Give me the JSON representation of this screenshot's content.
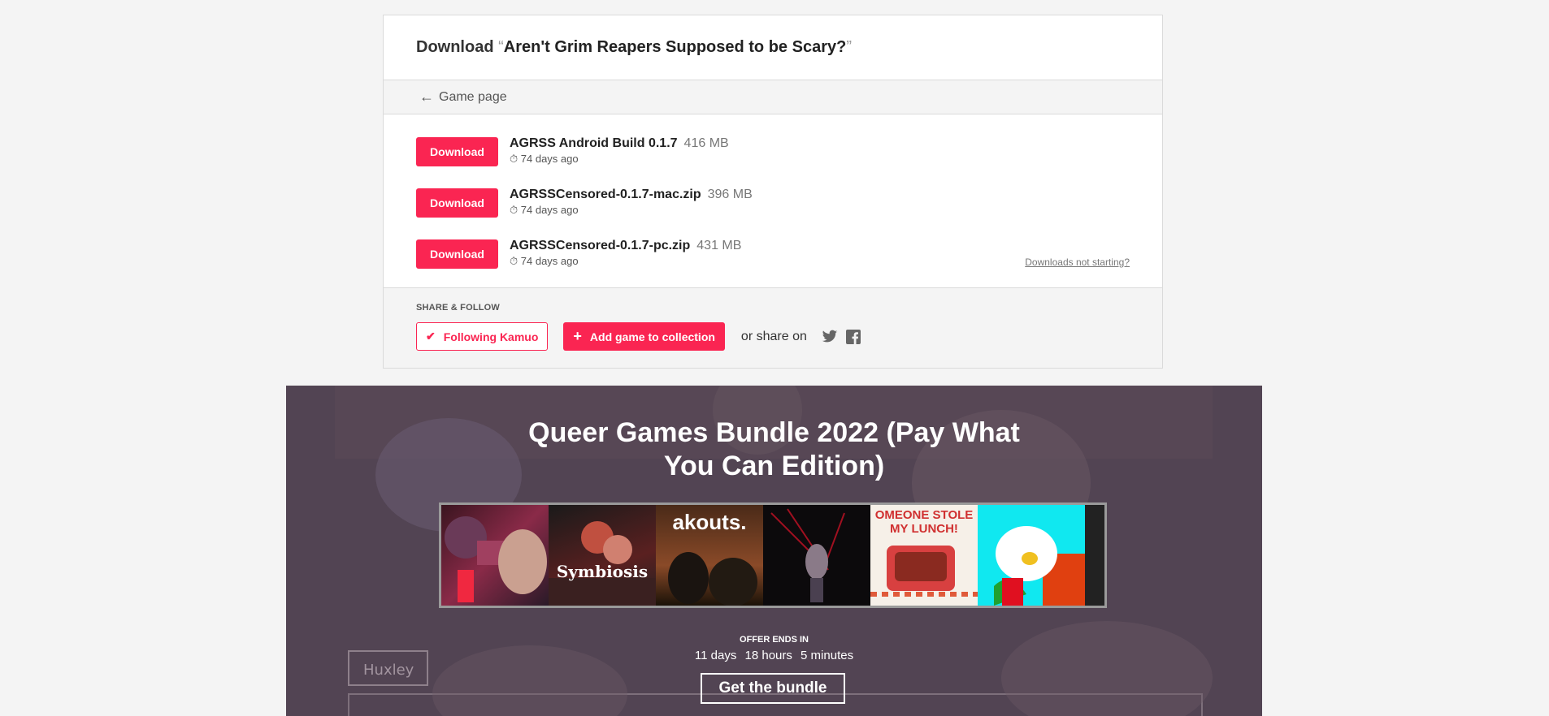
{
  "header": {
    "prefix": "Download",
    "open_quote": "“",
    "game_title": "Aren't Grim Reapers Supposed to be Scary?",
    "close_quote": "”"
  },
  "nav": {
    "back_label": "Game page",
    "back_arrow": "←"
  },
  "uploads": [
    {
      "button": "Download",
      "name": "AGRSS Android Build 0.1.7",
      "size": "416 MB",
      "date": "74 days ago"
    },
    {
      "button": "Download",
      "name": "AGRSSCensored-0.1.7-mac.zip",
      "size": "396 MB",
      "date": "74 days ago"
    },
    {
      "button": "Download",
      "name": "AGRSSCensored-0.1.7-pc.zip",
      "size": "431 MB",
      "date": "74 days ago"
    }
  ],
  "downloads_not_starting": "Downloads not starting?",
  "share": {
    "title": "SHARE & FOLLOW",
    "follow_label": "Following Kamuo",
    "collection_label": "Add game to collection",
    "share_on": "or share on",
    "icons": [
      "twitter-icon",
      "facebook-icon"
    ]
  },
  "bundle": {
    "title": "Queer Games Bundle 2022 (Pay What You Can Edition)",
    "covers": [
      "",
      "Symbiosis",
      "akouts.",
      "",
      "OMEONE STOLE MY LUNCH!",
      ""
    ],
    "offer_label": "OFFER ENDS IN",
    "days": "11 days",
    "hours": "18 hours",
    "minutes": "5 minutes",
    "button": "Get the bundle"
  },
  "colors": {
    "accent": "#fa2552",
    "bundle_bg": "#564857"
  }
}
